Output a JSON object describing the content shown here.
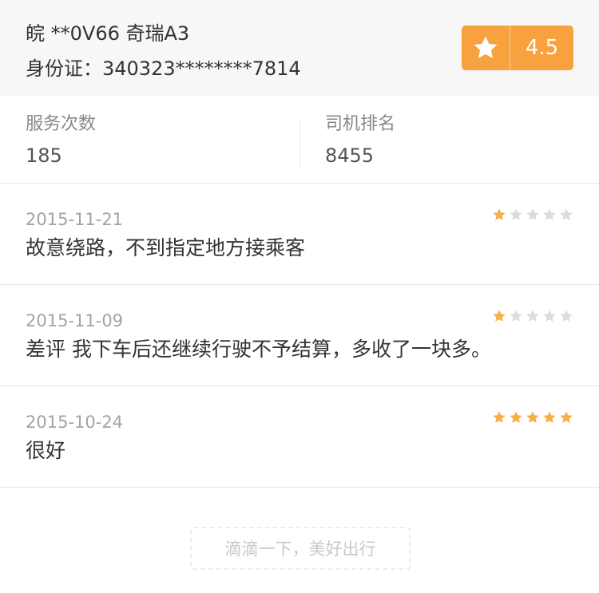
{
  "header": {
    "plate": "皖 **0V66 奇瑞A3",
    "id_card": "身份证：340323********7814",
    "rating": "4.5",
    "rating_icon": "star-icon"
  },
  "stats": {
    "service_label": "服务次数",
    "service_value": "185",
    "rank_label": "司机排名",
    "rank_value": "8455"
  },
  "reviews": [
    {
      "date": "2015-11-21",
      "text": "故意绕路，不到指定地方接乘客",
      "stars": 1
    },
    {
      "date": "2015-11-09",
      "text": "差评 我下车后还继续行驶不予结算，多收了一块多。",
      "stars": 1
    },
    {
      "date": "2015-10-24",
      "text": "很好",
      "stars": 5
    }
  ],
  "colors": {
    "accent": "#f7a23e",
    "star_filled": "#f5b04a",
    "star_empty": "#dcdcdc"
  },
  "footer": {
    "slogan": "滴滴一下，美好出行"
  }
}
